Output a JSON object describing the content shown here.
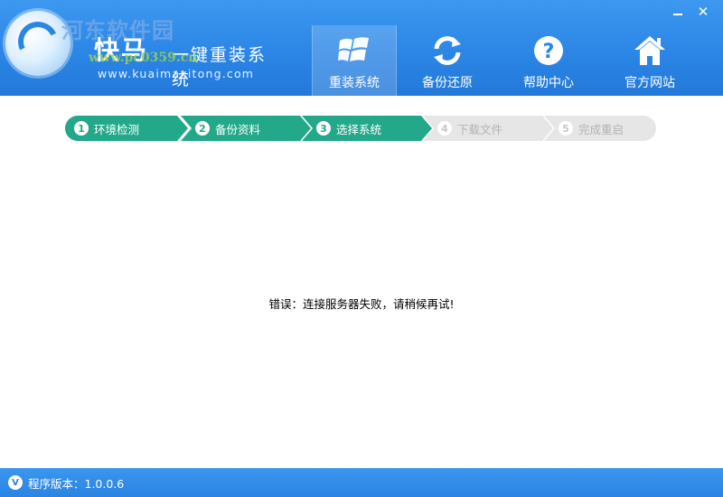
{
  "window": {
    "minimize_label": "—",
    "close_label": "✕"
  },
  "brand": {
    "title": "快马",
    "subtitle": "一键重装系统",
    "url": "www.kuaimaxitong.com",
    "watermark_top": "河东软件园",
    "watermark_bottom": "www.pc0359.cn"
  },
  "nav": {
    "items": [
      {
        "label": "重装系统",
        "icon": "windows-icon",
        "active": true
      },
      {
        "label": "备份还原",
        "icon": "refresh-icon",
        "active": false
      },
      {
        "label": "帮助中心",
        "icon": "help-icon",
        "active": false
      },
      {
        "label": "官方网站",
        "icon": "home-icon",
        "active": false
      }
    ]
  },
  "steps": [
    {
      "num": "1",
      "label": "环境检测",
      "state": "done"
    },
    {
      "num": "2",
      "label": "备份资料",
      "state": "done"
    },
    {
      "num": "3",
      "label": "选择系统",
      "state": "done"
    },
    {
      "num": "4",
      "label": "下载文件",
      "state": "todo"
    },
    {
      "num": "5",
      "label": "完成重启",
      "state": "todo"
    }
  ],
  "main": {
    "error": "错误：连接服务器失败，请稍候再试!"
  },
  "footer": {
    "badge": "V",
    "version_text": "程序版本：1.0.0.6"
  },
  "colors": {
    "header_blue": "#2b86e6",
    "step_done": "#23a98a",
    "step_todo": "#e6e6e6"
  }
}
